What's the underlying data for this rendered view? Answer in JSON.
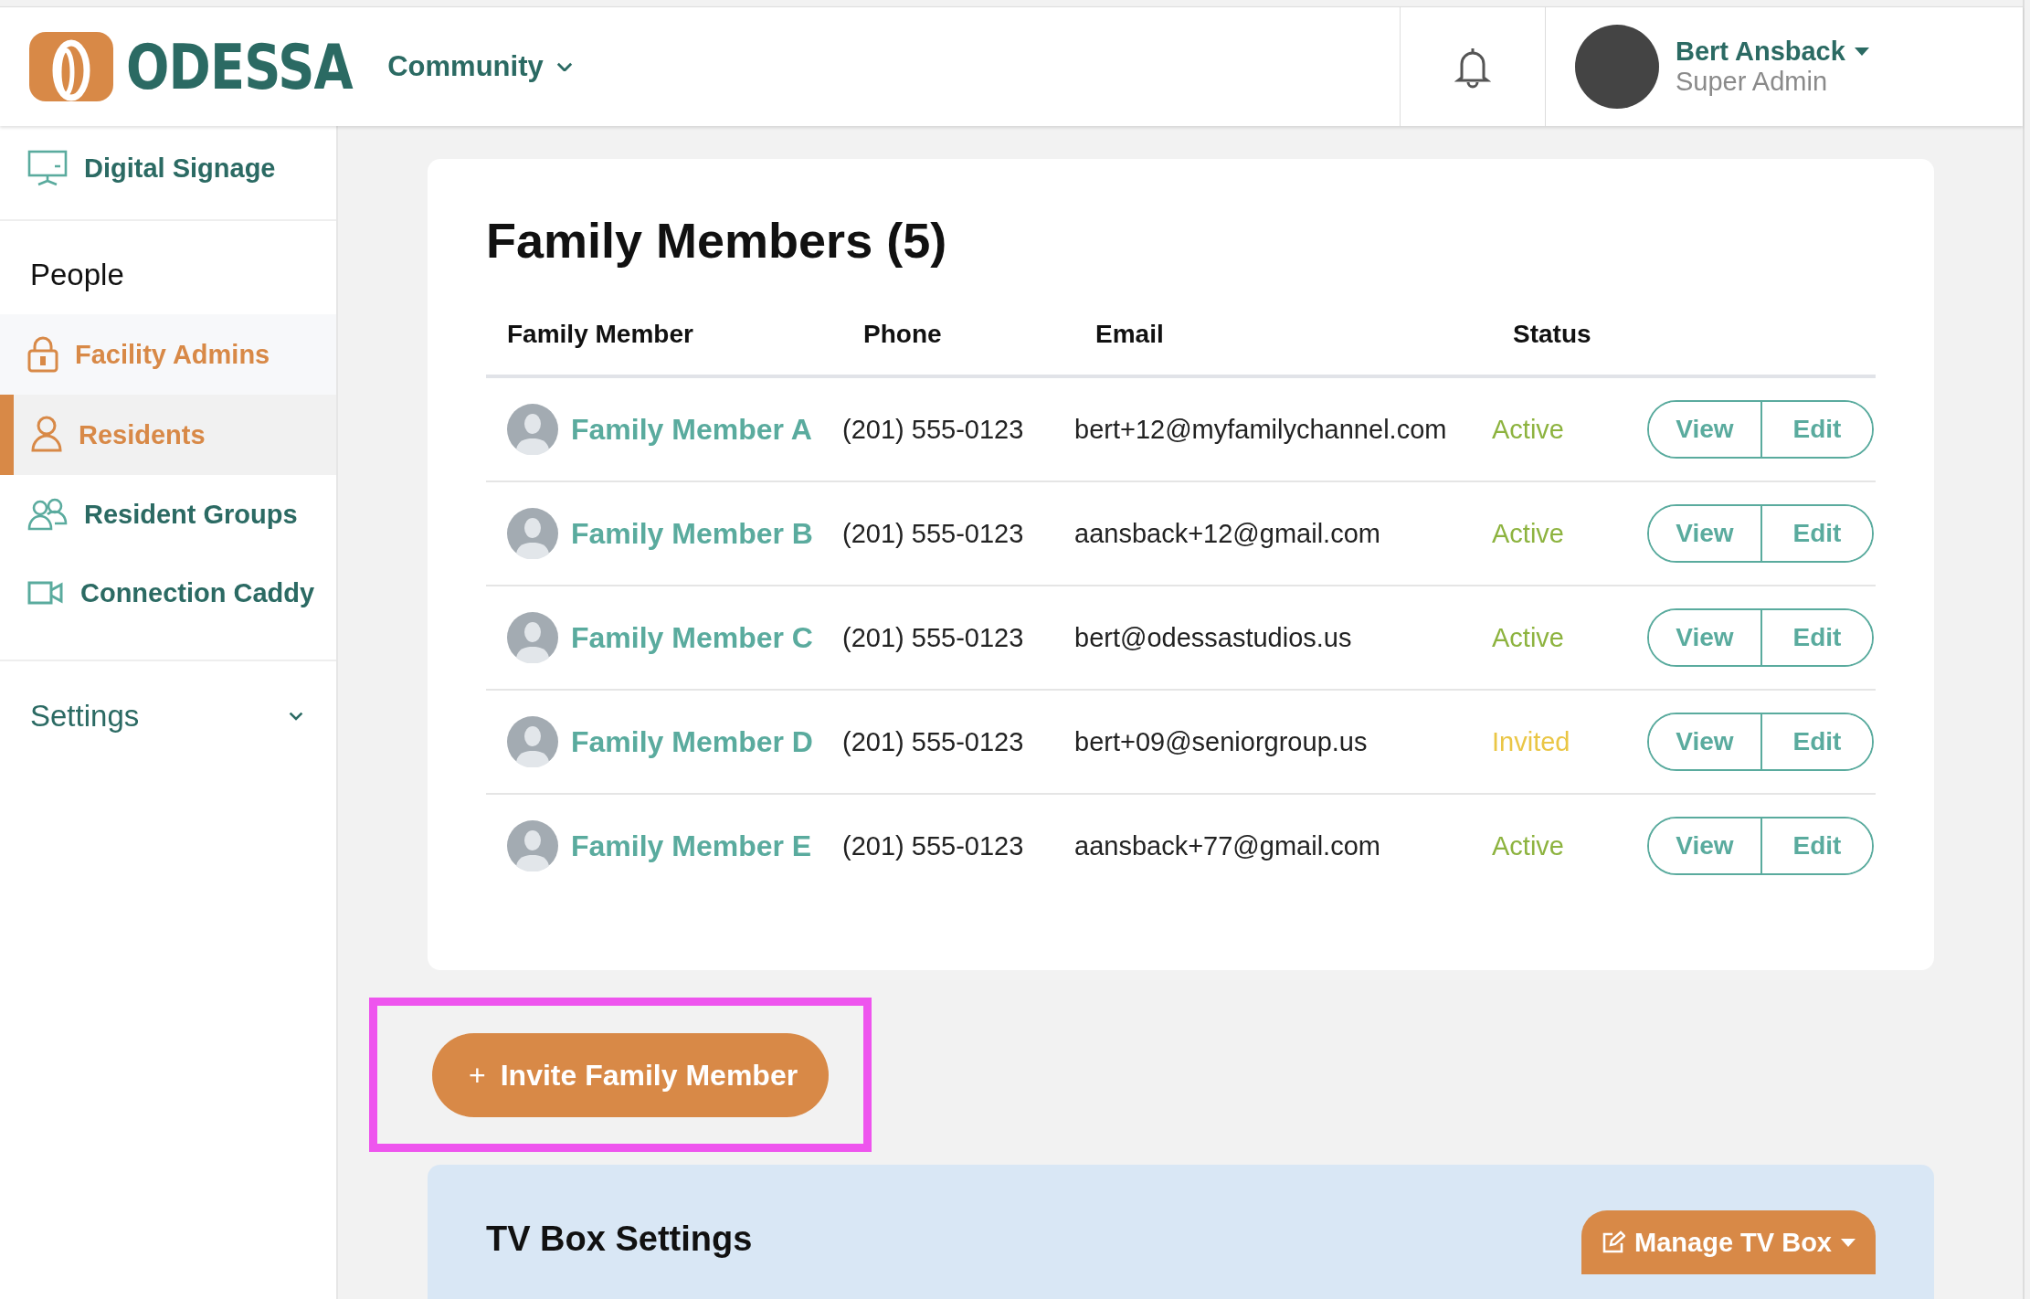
{
  "header": {
    "logo_text": "ODESSA",
    "community": {
      "label": "Community"
    },
    "user": {
      "name": "Bert Ansback",
      "role": "Super Admin"
    }
  },
  "sidebar": {
    "top_items": [
      {
        "label": "Digital Signage",
        "selected": false
      }
    ],
    "section_title": "People",
    "items": [
      {
        "label": "Facility Admins",
        "selected": false,
        "hovered": true
      },
      {
        "label": "Residents",
        "selected": true,
        "hovered": false
      },
      {
        "label": "Resident Groups",
        "selected": false,
        "hovered": false
      },
      {
        "label": "Connection Caddy",
        "selected": false,
        "hovered": false
      }
    ],
    "settings": {
      "label": "Settings",
      "expanded": false
    }
  },
  "family_members": {
    "title": "Family Members (5)",
    "columns": [
      "Family Member",
      "Phone",
      "Email",
      "Status"
    ],
    "rows": [
      {
        "name": "Family Member A",
        "phone": "(201) 555-0123",
        "email": "bert+12@myfamilychannel.com",
        "status": "Active",
        "color": "#8db33f",
        "actions": [
          "View",
          "Edit"
        ]
      },
      {
        "name": "Family Member B",
        "phone": "(201) 555-0123",
        "email": "aansback+12@gmail.com",
        "status": "Active",
        "color": "#8db33f",
        "actions": [
          "View",
          "Edit"
        ]
      },
      {
        "name": "Family Member C",
        "phone": "(201) 555-0123",
        "email": "bert@odessastudios.us",
        "status": "Active",
        "color": "#8db33f",
        "actions": [
          "View",
          "Edit"
        ]
      },
      {
        "name": "Family Member D",
        "phone": "(201) 555-0123",
        "email": "bert+09@seniorgroup.us",
        "status": "Invited",
        "color": "#eac645",
        "actions": [
          "View",
          "Edit"
        ]
      },
      {
        "name": "Family Member E",
        "phone": "(201) 555-0123",
        "email": "aansback+77@gmail.com",
        "status": "Active",
        "color": "#8db33f",
        "actions": [
          "View",
          "Edit"
        ]
      }
    ]
  },
  "invite_button": {
    "icon_text": "+",
    "label": "Invite Family Member",
    "highlighted": true
  },
  "tv_box": {
    "title": "TV Box Settings",
    "button": {
      "label": "Manage TV Box"
    }
  }
}
